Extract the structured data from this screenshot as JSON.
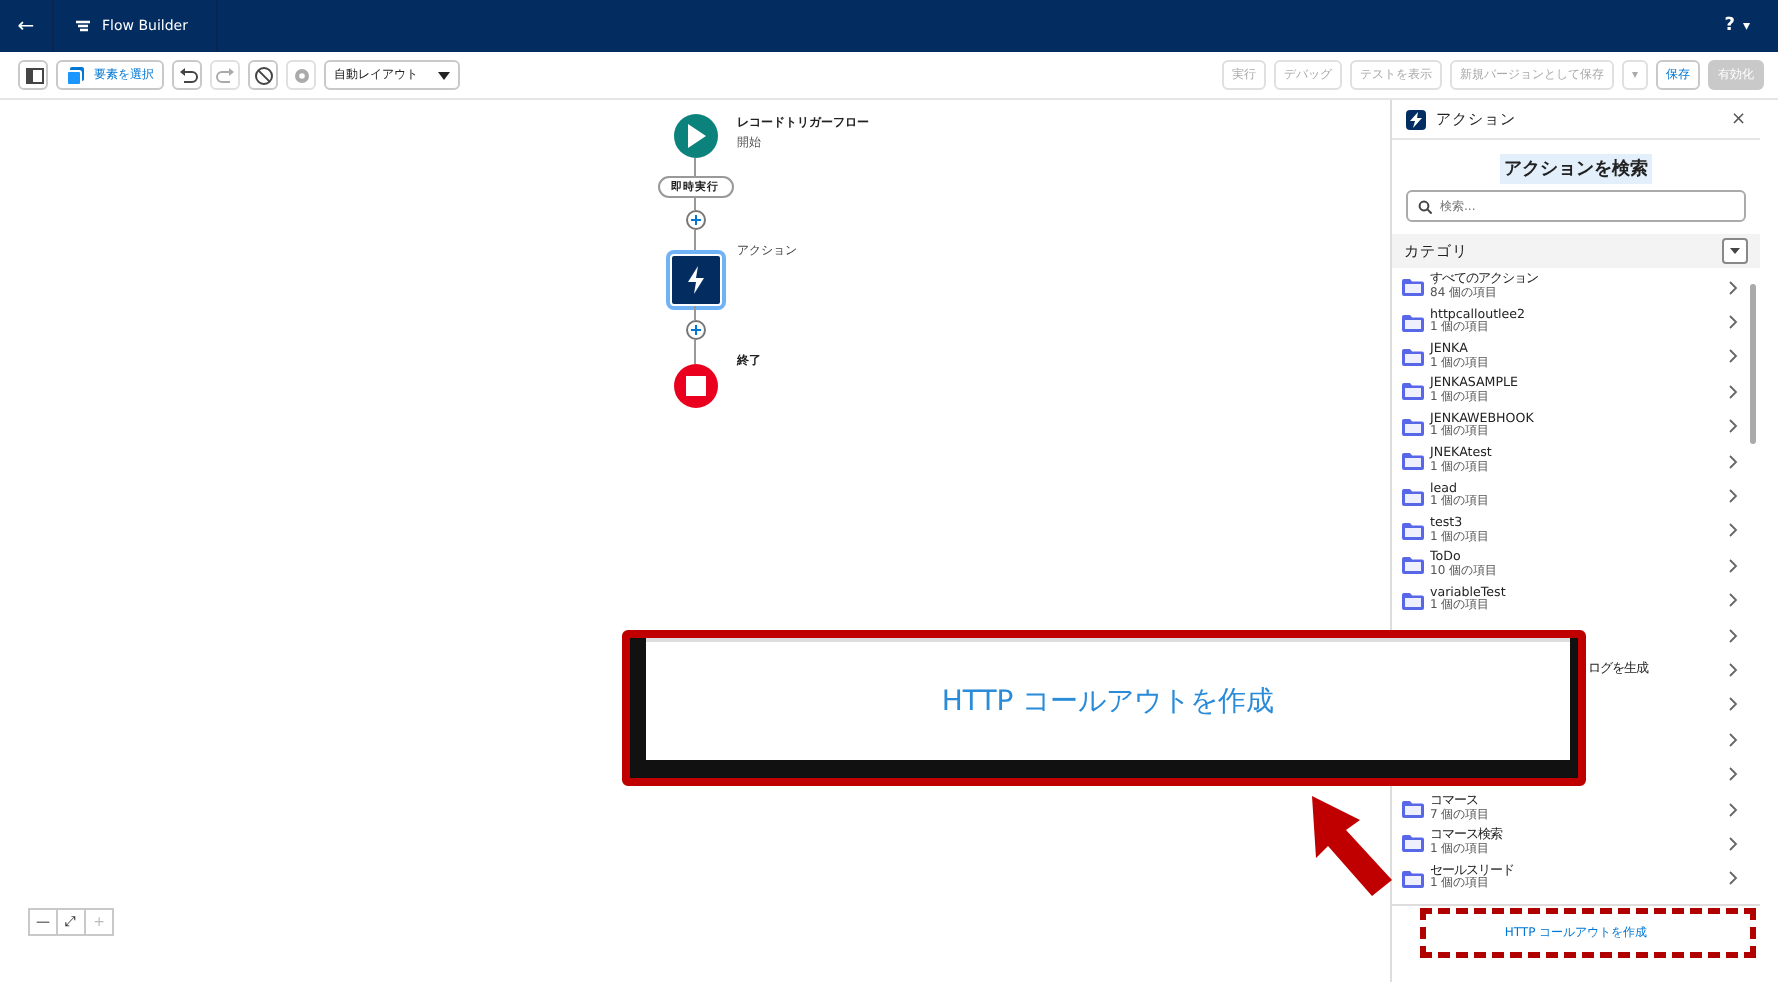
{
  "header": {
    "back": "←",
    "app_title": "Flow Builder",
    "help": "?",
    "help_caret": "▾"
  },
  "toolbar": {
    "left": [
      {
        "kind": "icon",
        "disabled": false
      },
      {
        "kind": "labeled",
        "label": "要素を選択",
        "disabled": false
      },
      {
        "kind": "icon",
        "disabled": false
      },
      {
        "kind": "icon",
        "disabled": true
      },
      {
        "kind": "icon",
        "disabled": false
      },
      {
        "kind": "icon",
        "disabled": true
      },
      {
        "kind": "dropdown",
        "label": "自動レイアウト",
        "disabled": false
      }
    ],
    "right": [
      {
        "kind": "plain",
        "label": "実行",
        "disabled": true
      },
      {
        "kind": "plain",
        "label": "デバッグ",
        "disabled": true
      },
      {
        "kind": "plain",
        "label": "テストを表示",
        "disabled": true
      },
      {
        "kind": "plain",
        "label": "新規バージョンとして保存",
        "disabled": true
      },
      {
        "kind": "plain",
        "label": "▾",
        "disabled": true
      },
      {
        "kind": "plain",
        "label": "保存",
        "disabled": false
      },
      {
        "kind": "primary",
        "label": "有効化",
        "disabled": true
      }
    ]
  },
  "canvas": {
    "nodes": [
      {
        "kind": "start",
        "title": "レコードトリガーフロー",
        "subtitle": "開始",
        "selected": false
      },
      {
        "kind": "pill",
        "title": "即時実行"
      },
      {
        "kind": "add"
      },
      {
        "kind": "action",
        "title": "アクション",
        "selected": true
      },
      {
        "kind": "add"
      },
      {
        "kind": "end",
        "title": "終了",
        "selected": false
      }
    ],
    "zoom_controls": [
      "—",
      "⤢",
      "+"
    ]
  },
  "panel": {
    "title": "アクション",
    "close": "×",
    "search_heading": "アクションを検索",
    "search": {
      "placeholder": "検索..."
    },
    "category_label": "カテゴリ",
    "categories": [
      {
        "kind": "full",
        "name": "すべてのアクション",
        "count": "84 個の項目"
      },
      {
        "kind": "full",
        "name": "httpcalloutlee2",
        "count": "1 個の項目"
      },
      {
        "kind": "full",
        "name": "JENKA",
        "count": "1 個の項目"
      },
      {
        "kind": "full",
        "name": "JENKASAMPLE",
        "count": "1 個の項目"
      },
      {
        "kind": "full",
        "name": "JENKAWEBHOOK",
        "count": "1 個の項目"
      },
      {
        "kind": "full",
        "name": "JNEKAtest",
        "count": "1 個の項目"
      },
      {
        "kind": "full",
        "name": "lead",
        "count": "1 個の項目"
      },
      {
        "kind": "full",
        "name": "test3",
        "count": "1 個の項目"
      },
      {
        "kind": "full",
        "name": "ToDo",
        "count": "10 個の項目"
      },
      {
        "kind": "full",
        "name": "variableTest",
        "count": "1 個の項目"
      },
      {
        "kind": "covered"
      },
      {
        "kind": "covered",
        "name": "ログを生成"
      },
      {
        "kind": "covered"
      },
      {
        "kind": "covered"
      },
      {
        "kind": "covered"
      },
      {
        "kind": "full",
        "name": "コマース",
        "count": "7 個の項目"
      },
      {
        "kind": "full",
        "name": "コマース検索",
        "count": "1 個の項目"
      },
      {
        "kind": "full",
        "name": "セールスリード",
        "count": "1 個の項目"
      }
    ],
    "footer_link": "HTTP コールアウトを作成"
  },
  "callout": {
    "text": "HTTP コールアウトを作成"
  }
}
